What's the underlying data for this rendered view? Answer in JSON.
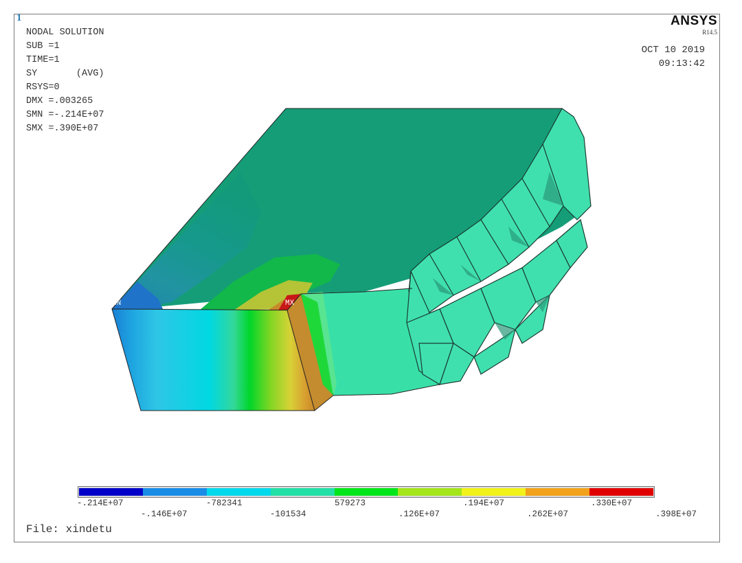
{
  "window": {
    "number": "1"
  },
  "info_lines": [
    "NODAL SOLUTION",
    "",
    "SUB =1",
    "TIME=1",
    "SY       (AVG)",
    "RSYS=0",
    "DMX =.003265",
    "SMN =-.214E+07",
    "SMX =.390E+07"
  ],
  "brand": {
    "name": "ANSYS",
    "release": "R14.5"
  },
  "timestamp": {
    "date": "OCT 10 2019",
    "time": "09:13:42"
  },
  "markers": {
    "min": "MN",
    "max": "MX"
  },
  "contour_legend": {
    "colors": [
      "#0000c8",
      "#1a8ce6",
      "#00d8ec",
      "#22e0a6",
      "#00e61a",
      "#a4e61a",
      "#f2f21a",
      "#f2a21a",
      "#e00000"
    ],
    "labels_upper": [
      "-.214E+07",
      "-782341",
      "579273",
      ".194E+07",
      ".330E+07"
    ],
    "labels_lower": [
      "-.146E+07",
      "-101534",
      ".126E+07",
      ".262E+07",
      ".398E+07"
    ]
  },
  "file": {
    "label": "File: xindetu"
  }
}
